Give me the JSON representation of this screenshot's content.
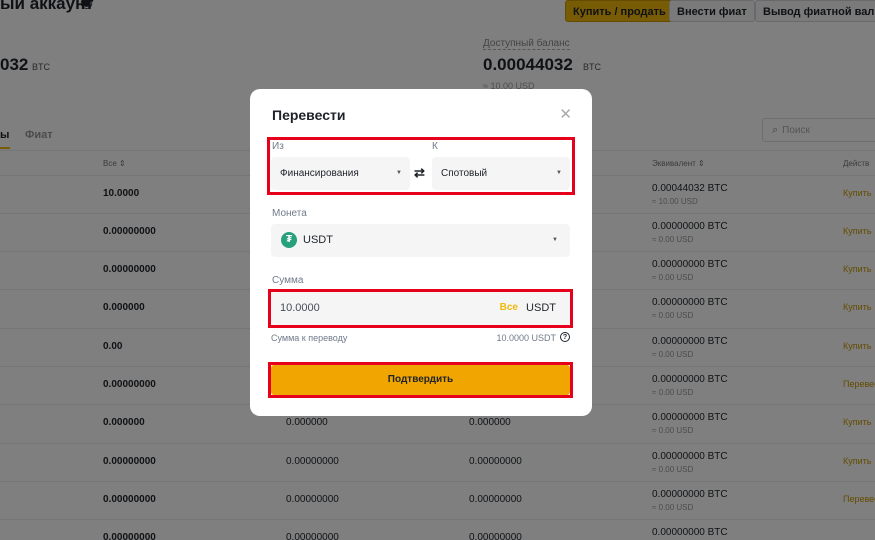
{
  "page": {
    "title": "ый аккаунт",
    "buttons": {
      "buy_sell": "Купить / продать",
      "deposit_fiat": "Внести фиат",
      "withdraw_fiat": "Вывод фиатной валюты"
    },
    "balance_left": {
      "value": "032",
      "unit": "BTC"
    },
    "balance_right": {
      "label": "Доступный баланс",
      "value": "0.00044032",
      "unit": "BTC",
      "sub": "≈ 10.00 USD"
    },
    "tabs": [
      "ы",
      "Фиат"
    ],
    "search_placeholder": "Поиск",
    "columns": {
      "all": "Все ⇕",
      "equivalent": "Эквивалент ⇕",
      "actions": "Действ"
    },
    "rows": [
      {
        "all": "10.0000",
        "c2": "",
        "c3": "",
        "eq": "0.00044032 BTC",
        "eq_usd": "≈ 10.00 USD",
        "action": "Купить"
      },
      {
        "all": "0.00000000",
        "c2": "",
        "c3": "",
        "eq": "0.00000000 BTC",
        "eq_usd": "≈ 0.00 USD",
        "action": "Купить"
      },
      {
        "all": "0.00000000",
        "c2": "",
        "c3": "",
        "eq": "0.00000000 BTC",
        "eq_usd": "≈ 0.00 USD",
        "action": "Купить"
      },
      {
        "all": "0.000000",
        "c2": "",
        "c3": "",
        "eq": "0.00000000 BTC",
        "eq_usd": "≈ 0.00 USD",
        "action": "Купить"
      },
      {
        "all": "0.00",
        "c2": "",
        "c3": "",
        "eq": "0.00000000 BTC",
        "eq_usd": "≈ 0.00 USD",
        "action": "Купить"
      },
      {
        "all": "0.00000000",
        "c2": "",
        "c3": "",
        "eq": "0.00000000 BTC",
        "eq_usd": "≈ 0.00 USD",
        "action": "Перевес"
      },
      {
        "all": "0.000000",
        "c2": "0.000000",
        "c3": "0.000000",
        "eq": "0.00000000 BTC",
        "eq_usd": "≈ 0.00 USD",
        "action": "Купить"
      },
      {
        "all": "0.00000000",
        "c2": "0.00000000",
        "c3": "0.00000000",
        "eq": "0.00000000 BTC",
        "eq_usd": "≈ 0.00 USD",
        "action": "Купить"
      },
      {
        "all": "0.00000000",
        "c2": "0.00000000",
        "c3": "0.00000000",
        "eq": "0.00000000 BTC",
        "eq_usd": "≈ 0.00 USD",
        "action": "Перевес"
      },
      {
        "all": "0.00000000",
        "c2": "0.00000000",
        "c3": "0.00000000",
        "eq": "0.00000000 BTC",
        "eq_usd": "",
        "action": ""
      }
    ]
  },
  "modal": {
    "title": "Перевести",
    "from_label": "Из",
    "from_value": "Финансирования",
    "to_label": "К",
    "to_value": "Спотовый",
    "coin_label": "Монета",
    "coin_value": "USDT",
    "amount_label": "Сумма",
    "amount_value": "10.0000",
    "max_label": "Все",
    "amount_unit": "USDT",
    "transfer_label": "Сумма к переводу",
    "transfer_value": "10.0000 USDT",
    "confirm_label": "Подтвердить"
  },
  "colors": {
    "accent": "#f0b90b",
    "confirm": "#f0a500",
    "highlight": "#e6001b",
    "usdt": "#26a17b"
  }
}
